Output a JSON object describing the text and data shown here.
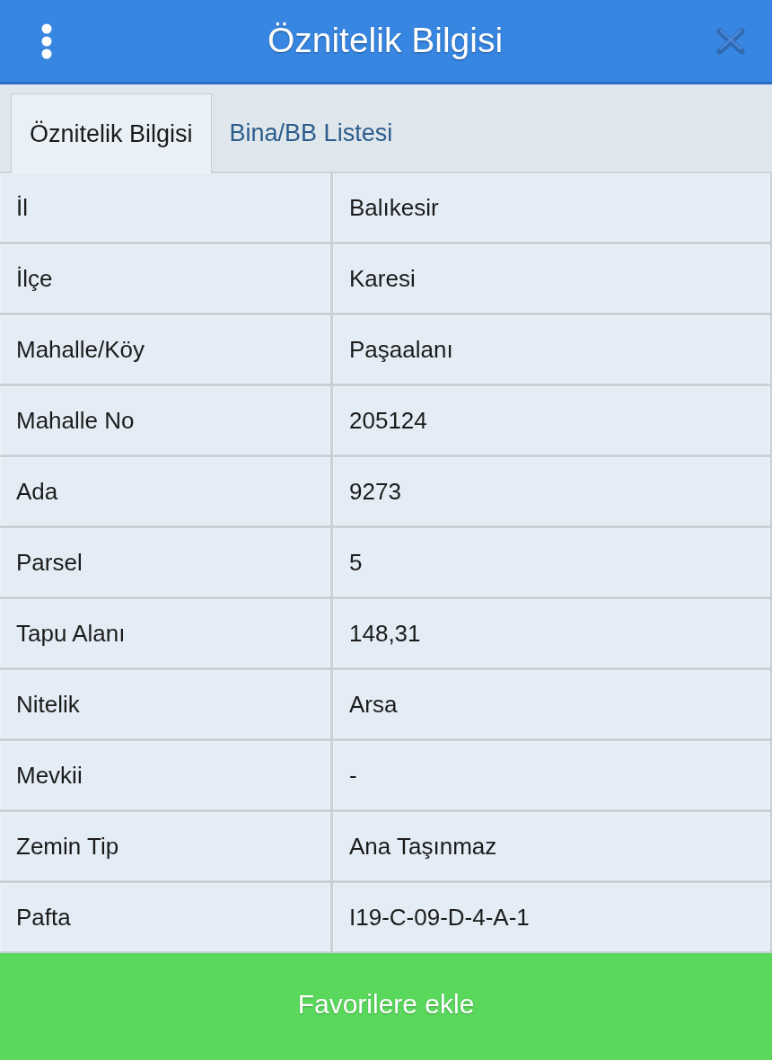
{
  "header": {
    "title": "Öznitelik Bilgisi"
  },
  "tabs": [
    {
      "label": "Öznitelik Bilgisi",
      "selected": true
    },
    {
      "label": "Bina/BB Listesi",
      "selected": false
    }
  ],
  "table": {
    "rows": [
      {
        "label": "İl",
        "value": "Balıkesir"
      },
      {
        "label": "İlçe",
        "value": "Karesi"
      },
      {
        "label": "Mahalle/Köy",
        "value": "Paşaalanı"
      },
      {
        "label": "Mahalle No",
        "value": "205124"
      },
      {
        "label": "Ada",
        "value": "9273"
      },
      {
        "label": "Parsel",
        "value": "5"
      },
      {
        "label": "Tapu Alanı",
        "value": "148,31"
      },
      {
        "label": "Nitelik",
        "value": "Arsa"
      },
      {
        "label": "Mevkii",
        "value": "-"
      },
      {
        "label": "Zemin Tip",
        "value": "Ana Taşınmaz"
      },
      {
        "label": "Pafta",
        "value": "I19-C-09-D-4-A-1"
      }
    ]
  },
  "footer_button": {
    "label": "Favorilere ekle"
  }
}
